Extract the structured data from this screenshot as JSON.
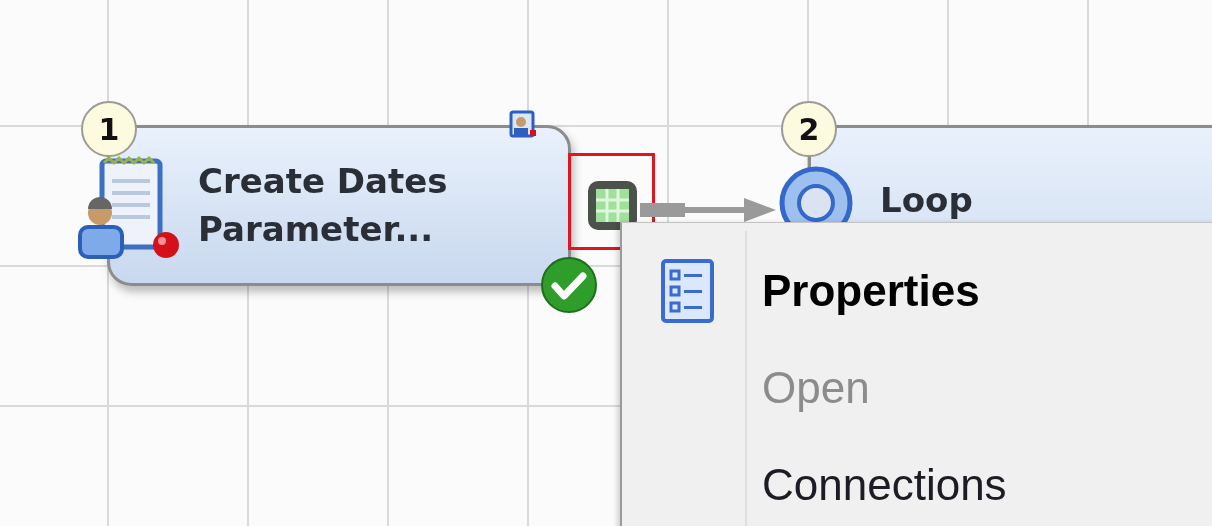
{
  "canvas": {
    "nodes": [
      {
        "number": "1",
        "kind": "user-written",
        "title": "Create Dates Parameter...",
        "success": true,
        "output_port": {
          "selected": true
        }
      },
      {
        "number": "2",
        "kind": "loop",
        "title": "Loop"
      }
    ]
  },
  "context_menu": {
    "items": [
      {
        "label": "Properties",
        "default": true,
        "disabled": false
      },
      {
        "label": "Open",
        "default": false,
        "disabled": true
      },
      {
        "label": "Connections",
        "default": false,
        "disabled": false
      }
    ]
  }
}
